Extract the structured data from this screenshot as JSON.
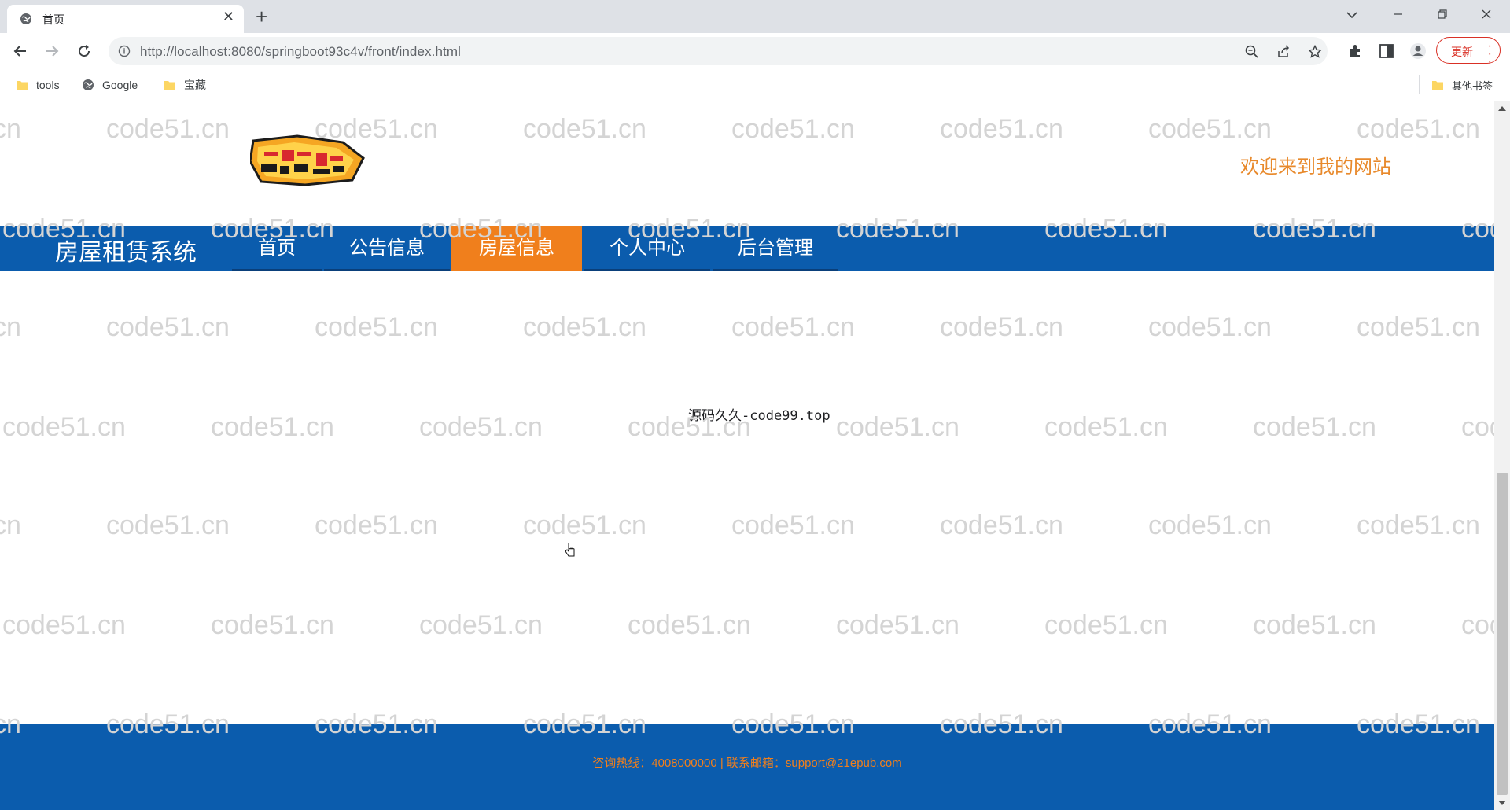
{
  "browser": {
    "tab": {
      "title": "首页",
      "favicon": "globe-icon"
    },
    "url": "http://localhost:8080/springboot93c4v/front/index.html",
    "update_label": "更新",
    "bookmarks": [
      {
        "label": "tools",
        "icon": "folder-icon"
      },
      {
        "label": "Google",
        "icon": "globe-icon"
      },
      {
        "label": "宝藏",
        "icon": "folder-icon"
      }
    ],
    "other_bookmarks": "其他书签"
  },
  "page": {
    "welcome": "欢迎来到我的网站",
    "logo_alt": "-BIGEYES-",
    "nav": {
      "brand": "房屋租赁系统",
      "items": [
        {
          "label": "首页",
          "active": false
        },
        {
          "label": "公告信息",
          "active": false
        },
        {
          "label": "房屋信息",
          "active": true
        },
        {
          "label": "个人中心",
          "active": false
        },
        {
          "label": "后台管理",
          "active": false
        }
      ]
    },
    "content_text": "源码久久-code99.top",
    "footer": "咨询热线：4008000000 | 联系邮箱：support@21epub.com",
    "watermark": "code51.cn"
  },
  "colors": {
    "nav_blue": "#0b5cad",
    "accent_orange": "#f07f1c",
    "welcome_orange": "#e8892b"
  }
}
